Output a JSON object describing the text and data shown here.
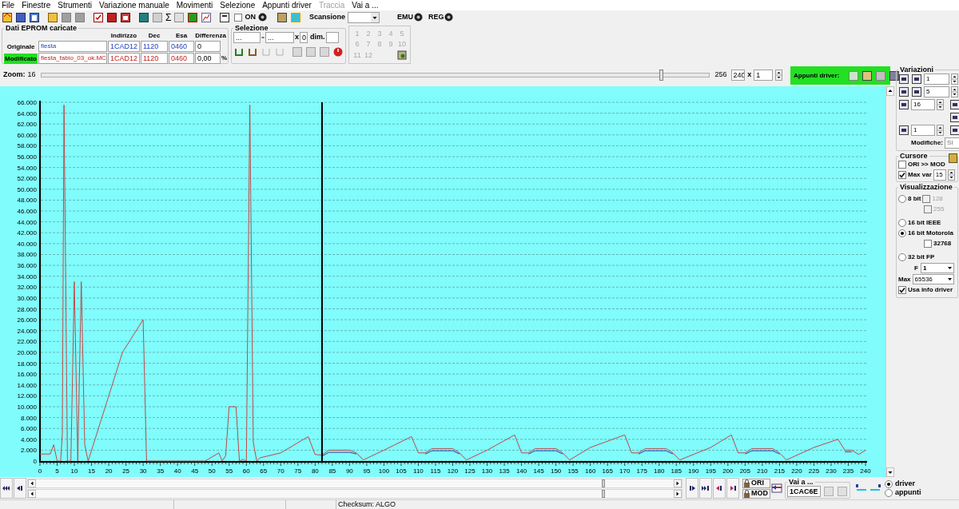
{
  "menu": [
    {
      "label": "File",
      "disabled": false
    },
    {
      "label": "Finestre",
      "disabled": false
    },
    {
      "label": "Strumenti",
      "disabled": false
    },
    {
      "label": "Variazione manuale",
      "disabled": false
    },
    {
      "label": "Movimenti",
      "disabled": false
    },
    {
      "label": "Selezione",
      "disabled": false
    },
    {
      "label": "Appunti driver",
      "disabled": false
    },
    {
      "label": "Traccia",
      "disabled": true
    },
    {
      "label": "Vai a ...",
      "disabled": false
    }
  ],
  "toolbar": {
    "sigma": "Σ",
    "on_label": "ON",
    "on_checked": false,
    "scan_label": "Scansione",
    "emu_label": "EMU",
    "reg_label": "REG"
  },
  "eprom": {
    "title": "Dati EPROM caricate",
    "columns": [
      "Indirizzo",
      "Dec",
      "Esa",
      "Differenza"
    ],
    "rows": [
      {
        "label": "Originale",
        "highlighted": false,
        "file": "fiesta",
        "address": "1CAD12",
        "dec": "1120",
        "hex": "0460",
        "diff": "0"
      },
      {
        "label": "Modificato",
        "highlighted": true,
        "file": "fiesta_fabio_03_ok.MC",
        "address": "1CAD12",
        "dec": "1120",
        "hex": "0460",
        "diff": "0,00",
        "unit": "%"
      }
    ]
  },
  "selezione": {
    "title": "Selezione",
    "from": "...",
    "to": "...",
    "x_label": "x",
    "x_value": "0",
    "dim_label": "dim."
  },
  "slots": [
    {
      "label": "1",
      "disabled": true
    },
    {
      "label": "2",
      "disabled": true
    },
    {
      "label": "3",
      "disabled": true
    },
    {
      "label": "4",
      "disabled": true
    },
    {
      "label": "5",
      "disabled": true
    },
    {
      "label": "6",
      "disabled": true
    },
    {
      "label": "7",
      "disabled": true
    },
    {
      "label": "8",
      "disabled": true
    },
    {
      "label": "9",
      "disabled": true
    },
    {
      "label": "10",
      "disabled": true
    },
    {
      "label": "11",
      "disabled": true
    },
    {
      "label": "12",
      "disabled": true
    }
  ],
  "zoom": {
    "label": "Zoom:",
    "min": "16",
    "max": "256",
    "level": 0.93,
    "value": "240",
    "x_label": "x",
    "factor": "1"
  },
  "appunti": {
    "label": "Appunti driver:"
  },
  "chart": {
    "chart_data": {
      "type": "line",
      "xlim": [
        0,
        240
      ],
      "ylim": [
        0,
        66000
      ],
      "xticks": [
        0,
        5,
        10,
        15,
        20,
        25,
        30,
        35,
        40,
        45,
        50,
        55,
        60,
        65,
        70,
        75,
        80,
        85,
        90,
        95,
        100,
        105,
        110,
        115,
        120,
        125,
        130,
        135,
        140,
        145,
        150,
        155,
        160,
        165,
        170,
        175,
        180,
        185,
        190,
        195,
        200,
        205,
        210,
        215,
        220,
        225,
        230,
        235,
        240
      ],
      "yticks": [
        {
          "value": 0,
          "label": "0"
        },
        {
          "value": 2000,
          "label": "2.000"
        },
        {
          "value": 4000,
          "label": "4.000"
        },
        {
          "value": 6000,
          "label": "6.000"
        },
        {
          "value": 8000,
          "label": "8.000"
        },
        {
          "value": 10000,
          "label": "10.000"
        },
        {
          "value": 12000,
          "label": "12.000"
        },
        {
          "value": 14000,
          "label": "14.000"
        },
        {
          "value": 16000,
          "label": "16.000"
        },
        {
          "value": 18000,
          "label": "18.000"
        },
        {
          "value": 20000,
          "label": "20.000"
        },
        {
          "value": 22000,
          "label": "22.000"
        },
        {
          "value": 24000,
          "label": "24.000"
        },
        {
          "value": 26000,
          "label": "26.000"
        },
        {
          "value": 28000,
          "label": "28.000"
        },
        {
          "value": 30000,
          "label": "30.000"
        },
        {
          "value": 32000,
          "label": "32.000"
        },
        {
          "value": 34000,
          "label": "34.000"
        },
        {
          "value": 36000,
          "label": "36.000"
        },
        {
          "value": 38000,
          "label": "38.000"
        },
        {
          "value": 40000,
          "label": "40.000"
        },
        {
          "value": 42000,
          "label": "42.000"
        },
        {
          "value": 44000,
          "label": "44.000"
        },
        {
          "value": 46000,
          "label": "46.000"
        },
        {
          "value": 48000,
          "label": "48.000"
        },
        {
          "value": 50000,
          "label": "50.000"
        },
        {
          "value": 52000,
          "label": "52.000"
        },
        {
          "value": 54000,
          "label": "54.000"
        },
        {
          "value": 56000,
          "label": "56.000"
        },
        {
          "value": 58000,
          "label": "58.000"
        },
        {
          "value": 60000,
          "label": "60.000"
        },
        {
          "value": 62000,
          "label": "62.000"
        },
        {
          "value": 64000,
          "label": "64.000"
        },
        {
          "value": 66000,
          "label": "66.000"
        }
      ],
      "x": [
        0,
        3,
        4,
        5,
        6,
        6.5,
        7,
        8,
        9,
        10,
        11,
        12,
        13,
        14,
        24,
        30,
        31,
        48,
        52,
        53,
        54,
        55,
        57,
        58,
        59,
        60,
        61,
        62,
        63,
        64,
        70,
        78,
        80,
        82,
        84,
        90,
        92,
        94,
        100,
        108,
        110,
        112,
        114,
        120,
        122,
        124,
        130,
        138,
        140,
        142,
        144,
        150,
        152,
        154,
        160,
        170,
        172,
        174,
        176,
        182,
        184,
        186,
        195,
        201,
        203,
        205,
        207,
        213,
        215,
        217,
        225,
        232,
        234,
        236,
        238,
        240
      ],
      "series": [
        {
          "color": "#3040a0",
          "values": [
            null,
            null,
            null,
            null,
            null,
            null,
            null,
            null,
            null,
            null,
            null,
            null,
            null,
            null,
            null,
            null,
            null,
            null,
            null,
            null,
            null,
            null,
            null,
            null,
            null,
            null,
            null,
            null,
            null,
            null,
            null,
            null,
            null,
            900,
            1600,
            1600,
            1300,
            null,
            null,
            null,
            null,
            1300,
            1900,
            1900,
            1300,
            null,
            null,
            null,
            null,
            1300,
            1900,
            1900,
            1300,
            null,
            null,
            null,
            null,
            1300,
            1900,
            1900,
            1300,
            null,
            null,
            null,
            null,
            1300,
            1900,
            1900,
            1300,
            null,
            null,
            null,
            1700,
            1700,
            null,
            null
          ]
        },
        {
          "color": "#c04848",
          "values": [
            1300,
            1300,
            3000,
            0,
            0,
            5000,
            65500,
            0,
            0,
            33000,
            0,
            33000,
            3000,
            0,
            20000,
            26000,
            0,
            0,
            1500,
            0,
            1000,
            10000,
            10000,
            0,
            300,
            0,
            65500,
            3500,
            0,
            600,
            1500,
            4500,
            1200,
            1100,
            2000,
            2000,
            1500,
            200,
            2000,
            4500,
            1500,
            1500,
            2300,
            2300,
            1500,
            200,
            2000,
            4800,
            1500,
            1500,
            2300,
            2300,
            1500,
            200,
            2500,
            4800,
            1500,
            1500,
            2300,
            2300,
            1500,
            200,
            2500,
            4800,
            1500,
            1500,
            2300,
            2300,
            1500,
            200,
            2500,
            4000,
            2000,
            2000,
            1200,
            2000
          ]
        }
      ],
      "grid": true,
      "ref_lines": [
        {
          "axis": "x",
          "value": 82,
          "color": "#000000"
        }
      ]
    }
  },
  "variazioni": {
    "title": "Variazioni",
    "step1": "1",
    "step2": "5",
    "a_value": "16",
    "p_value": "1",
    "modifiche_label": "Modifiche:",
    "modifiche_value": "SI"
  },
  "cursore": {
    "title": "Cursore",
    "ori_mod": {
      "label": "ORI >> MOD",
      "checked": false
    },
    "max_var": {
      "label": "Max var",
      "checked": true,
      "value": "15"
    }
  },
  "visualizzazione": {
    "title": "Visualizzazione",
    "options": [
      {
        "label": "8 bit",
        "selected": false
      },
      {
        "label": "16 bit IEEE",
        "selected": false
      },
      {
        "label": "16 bit Motorola",
        "selected": true
      },
      {
        "label": "32 bit FP",
        "selected": false
      }
    ],
    "opt_128": {
      "label": "128",
      "checked": false,
      "disabled": true
    },
    "opt_255": {
      "label": "255",
      "checked": false,
      "disabled": true
    },
    "opt_32768": {
      "label": "32768",
      "checked": false,
      "disabled": false
    },
    "f_label": "F",
    "f_value": "1",
    "max_label": "Max",
    "max_value": "65536",
    "usa": {
      "label": "Usa info driver",
      "checked": true
    }
  },
  "navigation": {
    "ori_label": "ORI",
    "mod_label": "MOD",
    "goto_title": "Vai a ...",
    "goto_value": "1CAC6E",
    "targets": [
      {
        "label": "driver",
        "selected": true
      },
      {
        "label": "appunti",
        "selected": false
      }
    ]
  },
  "status_bar": {
    "checksum": "Checksum: ALGO"
  }
}
